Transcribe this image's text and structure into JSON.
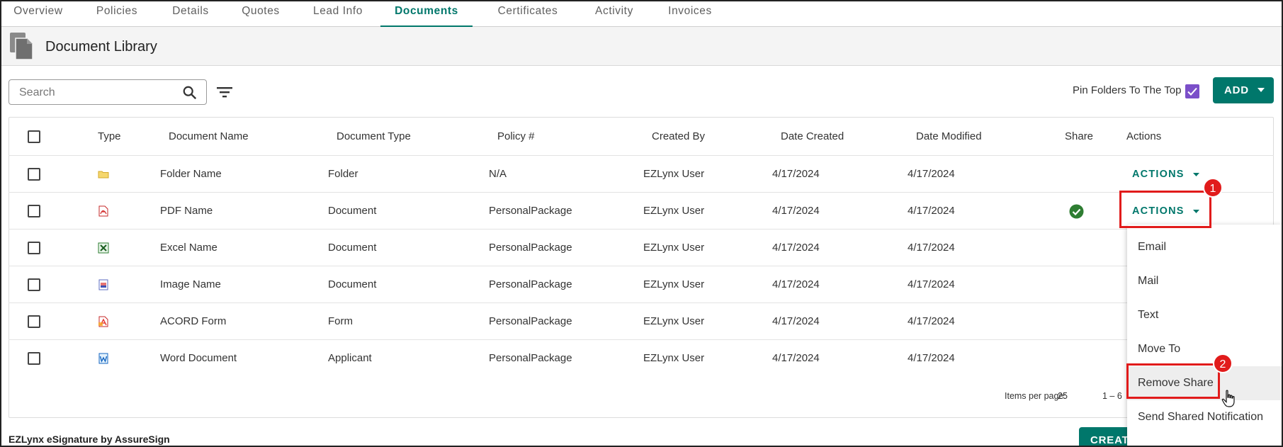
{
  "tabs": [
    {
      "label": "Overview"
    },
    {
      "label": "Policies"
    },
    {
      "label": "Details"
    },
    {
      "label": "Quotes"
    },
    {
      "label": "Lead Info"
    },
    {
      "label": "Documents",
      "active": true
    },
    {
      "label": "Certificates"
    },
    {
      "label": "Activity"
    },
    {
      "label": "Invoices"
    }
  ],
  "header": {
    "title": "Document Library",
    "icon": "documents-icon"
  },
  "toolbar": {
    "search_placeholder": "Search",
    "pin_label": "Pin Folders To The Top",
    "pin_checked": true,
    "add_label": "ADD"
  },
  "table": {
    "columns": [
      "Type",
      "Document Name",
      "Document Type",
      "Policy #",
      "Created By",
      "Date Created",
      "Date Modified",
      "Share",
      "Actions"
    ],
    "rows": [
      {
        "icon": "folder-icon",
        "name": "Folder Name",
        "doc_type": "Folder",
        "policy": "N/A",
        "created_by": "EZLynx User",
        "date_created": "4/17/2024",
        "date_modified": "4/17/2024",
        "shared": false,
        "action": "ACTIONS"
      },
      {
        "icon": "pdf-icon",
        "name": "PDF Name",
        "doc_type": "Document",
        "policy": "PersonalPackage",
        "created_by": "EZLynx User",
        "date_created": "4/17/2024",
        "date_modified": "4/17/2024",
        "shared": true,
        "action": "ACTIONS"
      },
      {
        "icon": "excel-icon",
        "name": "Excel Name",
        "doc_type": "Document",
        "policy": "PersonalPackage",
        "created_by": "EZLynx User",
        "date_created": "4/17/2024",
        "date_modified": "4/17/2024",
        "shared": false
      },
      {
        "icon": "image-icon",
        "name": "Image Name",
        "doc_type": "Document",
        "policy": "PersonalPackage",
        "created_by": "EZLynx User",
        "date_created": "4/17/2024",
        "date_modified": "4/17/2024",
        "shared": false
      },
      {
        "icon": "acord-form-icon",
        "name": "ACORD Form",
        "doc_type": "Form",
        "policy": "PersonalPackage",
        "created_by": "EZLynx User",
        "date_created": "4/17/2024",
        "date_modified": "4/17/2024",
        "shared": false
      },
      {
        "icon": "word-icon",
        "name": "Word Document",
        "doc_type": "Applicant",
        "policy": "PersonalPackage",
        "created_by": "EZLynx User",
        "date_created": "4/17/2024",
        "date_modified": "4/17/2024",
        "shared": false
      }
    ]
  },
  "pager": {
    "label": "Items per page:",
    "value": "25",
    "range": "1 – 6"
  },
  "actions_menu": {
    "items": [
      "Email",
      "Mail",
      "Text",
      "Move To",
      "Remove Share",
      "Send Shared Notification"
    ],
    "hovered": "Remove Share"
  },
  "annotations": {
    "step1": "1",
    "step2": "2"
  },
  "footer": {
    "title": "EZLynx eSignature by AssureSign",
    "create_label": "CREATE"
  },
  "colors": {
    "accent": "#00776b",
    "highlight": "#e11b1b",
    "checkbox": "#7b4fc9"
  }
}
